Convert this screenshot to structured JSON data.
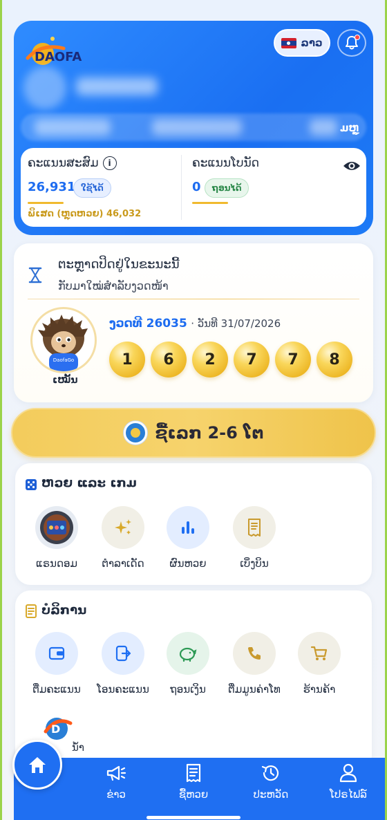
{
  "header": {
    "logo_text": "DAOFA",
    "language_label": "ລາວ",
    "member_tag": "ມຫຼູ",
    "points": {
      "accumulated_title": "ຄະແນນສະສົມ",
      "accumulated_value": "26,931",
      "usable_label": "ໃຊ້ໄດ້",
      "special_text": "ພິເສດ (ຫຼຸດຫວຍ) 46,032",
      "bonus_title": "ຄະແນນໂບນັດ",
      "bonus_value": "0",
      "withdrawable_label": "ຖອນໄດ້"
    }
  },
  "draw": {
    "title": "ຕະຫຼາດປິດຢູ່ໃນຂະນະນີ້",
    "subtitle": "ກັບມາໃໝ່ສຳລັບງວດໜ້າ",
    "mascot_badge": "DaofaGo",
    "mascot_label": "ເໝັ້ນ",
    "round_label": "ງວດທີ 26035",
    "date_label": "· ວັນທີ 31/07/2026",
    "numbers": [
      "1",
      "6",
      "2",
      "7",
      "7",
      "8"
    ]
  },
  "buy_button": {
    "label": "ຊື້ເລກ 2-6 ໂຕ"
  },
  "games_section": {
    "title": "ຫວຍ ແລະ ເກມ",
    "items": [
      {
        "label": "ແຣນດອມ",
        "icon": "random-machine-icon"
      },
      {
        "label": "ຕຳລາເດັດ",
        "icon": "sparkle-icon"
      },
      {
        "label": "ຜົນຫວຍ",
        "icon": "bar-chart-icon"
      },
      {
        "label": "ເບິ່ງບິນ",
        "icon": "receipt-icon"
      }
    ]
  },
  "services_section": {
    "title": "ບໍລິການ",
    "items": [
      {
        "label": "ຕື່ມຄະແນນ",
        "icon": "wallet-icon"
      },
      {
        "label": "ໂອນຄະແນນ",
        "icon": "transfer-icon"
      },
      {
        "label": "ຖອນເງິນ",
        "icon": "piggy-bank-icon"
      },
      {
        "label": "ຕື່ມມູນຄ່າໂທ",
        "icon": "phone-icon"
      },
      {
        "label": "ຮ້ານຄ້າ",
        "icon": "cart-icon"
      }
    ],
    "extra_label": "ນ້ຳ"
  },
  "bottom_nav": {
    "items": [
      {
        "label": "ຂ່າວ",
        "icon": "megaphone-icon"
      },
      {
        "label": "ຊື້ຫວຍ",
        "icon": "ticket-icon"
      },
      {
        "label": "ປະຫວັດ",
        "icon": "history-icon"
      },
      {
        "label": "ໂປຣໄຟລ໌",
        "icon": "user-icon"
      }
    ]
  },
  "colors": {
    "brand_blue": "#1f6ff2",
    "gold": "#f3cc5c"
  }
}
